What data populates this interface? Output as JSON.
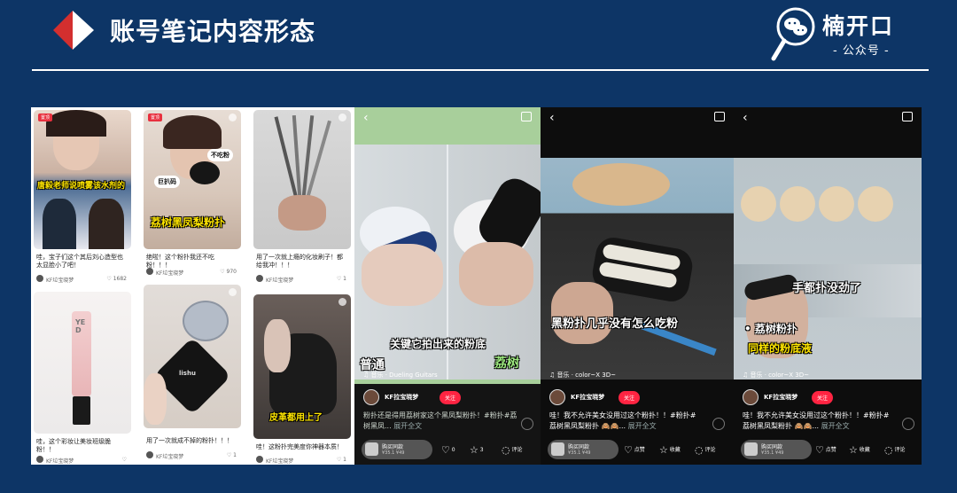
{
  "header": {
    "title": "账号笔记内容形态",
    "logo_name": "楠开口",
    "logo_sub": "- 公众号 -"
  },
  "feed": {
    "cards": [
      {
        "tag": "置顶",
        "overlay": "唐毅老师说喷雾该水剂的",
        "caption": "哇，宝子们这个其后刘心造型也太显脸小了吧！",
        "author": "KF垃宝晓梦",
        "likes": "1682"
      },
      {
        "tag": "置顶",
        "overlay": "荔树黑凤梨粉扑",
        "bubble1": "巨扒码",
        "bubble2": "不吃粉",
        "caption": "绝啦！这个粉扑我还不吃粉！！！",
        "author": "KF垃宝晓梦",
        "likes": "970"
      },
      {
        "caption": "用了一次就上瘾的化妆刷子！都给我冲！！！",
        "author": "KF垃宝晓梦",
        "likes": "1"
      },
      {
        "overlay": "YED",
        "caption": "哇，这个彩妆让美妆班级脆粉！！",
        "author": "KF垃宝晓梦",
        "likes": ""
      },
      {
        "caption": "用了一次就成不掉的粉扑！！！",
        "author": "KF垃宝晓梦",
        "likes": "1"
      },
      {
        "overlay": "皮革都用上了",
        "caption": "哇！这粉扑完美度你神器本质！",
        "author": "KF垃宝晓梦",
        "likes": "1"
      }
    ]
  },
  "phone1": {
    "overlay_main": "关键它拍出来的粉底",
    "overlay_left": "普通",
    "overlay_right": "荔树",
    "music": "♫ 音乐 · Dueling Guitars",
    "author": "KF拉宝晓梦",
    "follow": "关注",
    "desc": "粉扑还是得用荔树家这个黑凤梨粉扑！#粉扑#荔树黑凤...",
    "desc_more": "展开全文",
    "buy_label": "购买同款",
    "buy_price": "¥35.1 ¥49",
    "like_count": "0",
    "star_count": "3",
    "comment_label": "评论"
  },
  "phone2": {
    "overlay": "黑粉扑几乎没有怎么吃粉",
    "music": "♫ 音乐 · color~X 3D~",
    "author": "KF拉宝晓梦",
    "follow": "关注",
    "desc": "哇！我不允许美女没用过这个粉扑！！#粉扑#荔树黑凤梨粉扑 🙈🙈...",
    "desc_more": "展开全文",
    "buy_label": "购买同款",
    "buy_price": "¥35.1 ¥49",
    "like_label": "点赞",
    "star_label": "收藏",
    "comment_label": "评论"
  },
  "phone3": {
    "overlay1": "手都扑没劲了",
    "overlay2": "• 荔树粉扑",
    "overlay3": "同样的粉底液",
    "music": "♫ 音乐 · color~X 3D~",
    "author": "KF拉宝晓梦",
    "follow": "关注",
    "desc": "哇！我不允许美女没用过这个粉扑！！#粉扑#荔树黑凤梨粉扑 🙈🙈...",
    "desc_more": "展开全文",
    "buy_label": "购买同款",
    "buy_price": "¥35.1 ¥49",
    "like_label": "点赞",
    "star_label": "收藏",
    "comment_label": "评论"
  },
  "colors": {
    "background": "#0d3566",
    "accent_red": "#d32f2f",
    "follow_red": "#ff2442",
    "overlay_yellow": "#ffe600"
  }
}
